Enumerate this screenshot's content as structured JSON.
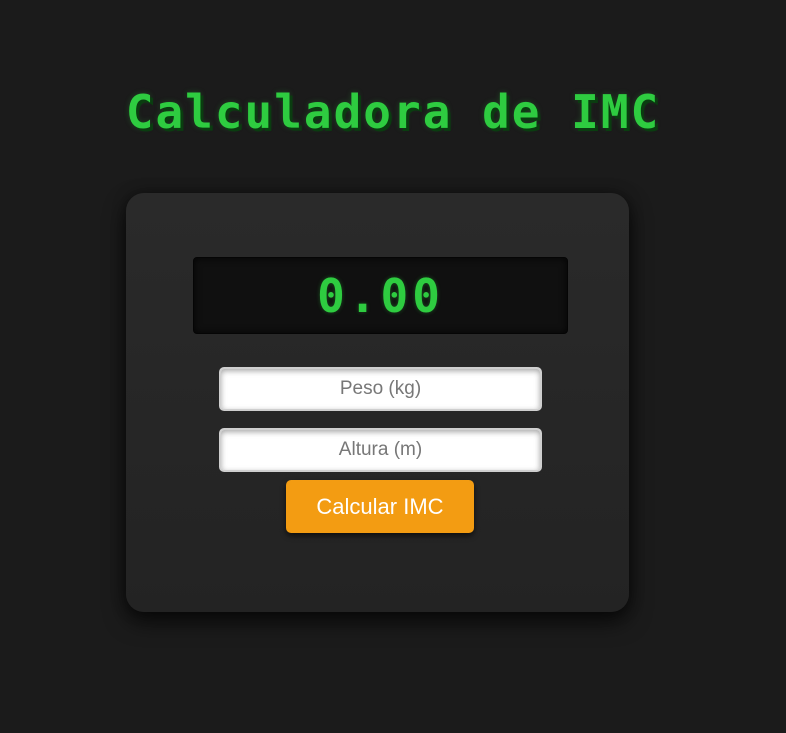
{
  "header": {
    "title": "Calculadora de IMC"
  },
  "display": {
    "value": "0.00"
  },
  "form": {
    "weight_placeholder": "Peso (kg)",
    "height_placeholder": "Altura (m)",
    "weight_value": "",
    "height_value": "",
    "submit_label": "Calcular IMC"
  },
  "colors": {
    "background": "#1b1b1b",
    "accent_green": "#2ecc40",
    "button_orange": "#f39c12",
    "card": "#262626",
    "display_bg": "#101010"
  }
}
